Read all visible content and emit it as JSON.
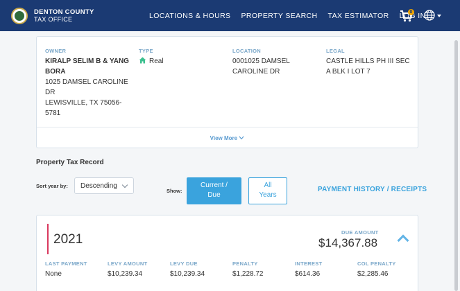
{
  "header": {
    "brand_title": "DENTON COUNTY",
    "brand_sub": "TAX OFFICE",
    "nav": [
      "LOCATIONS & HOURS",
      "PROPERTY SEARCH",
      "TAX ESTIMATOR",
      "LOG IN"
    ],
    "cart_count": "0"
  },
  "property": {
    "owner_label": "OWNER",
    "owner_name": "KIRALP SELIM B & YANG BORA",
    "owner_address_1": "1025 DAMSEL CAROLINE DR",
    "owner_address_2": "LEWISVILLE, TX 75056-5781",
    "type_label": "TYPE",
    "type_value": "Real",
    "location_label": "LOCATION",
    "location_value": "0001025 DAMSEL CAROLINE DR",
    "legal_label": "LEGAL",
    "legal_value": "CASTLE HILLS PH III SEC A BLK I LOT 7",
    "view_more": "View More"
  },
  "record": {
    "title": "Property Tax Record",
    "sort_label": "Sort year by:",
    "sort_value": "Descending",
    "show_label": "Show:",
    "btn_current": "Current / Due",
    "btn_all": "All Years",
    "payment_history": "PAYMENT HISTORY / RECEIPTS"
  },
  "year_card": {
    "year": "2021",
    "due_label": "DUE AMOUNT",
    "due_amount": "$14,367.88",
    "columns": [
      {
        "label": "LAST PAYMENT",
        "value": "None"
      },
      {
        "label": "LEVY AMOUNT",
        "value": "$10,239.34"
      },
      {
        "label": "LEVY DUE",
        "value": "$10,239.34"
      },
      {
        "label": "PENALTY",
        "value": "$1,228.72"
      },
      {
        "label": "INTEREST",
        "value": "$614.36"
      },
      {
        "label": "COL PENALTY",
        "value": "$2,285.46"
      }
    ]
  },
  "colors": {
    "header_bg": "#1b3a73",
    "accent": "#3aa3dd",
    "label": "#7aa7c9",
    "year_marker": "#d9385e",
    "type_icon": "#3cc08f"
  }
}
